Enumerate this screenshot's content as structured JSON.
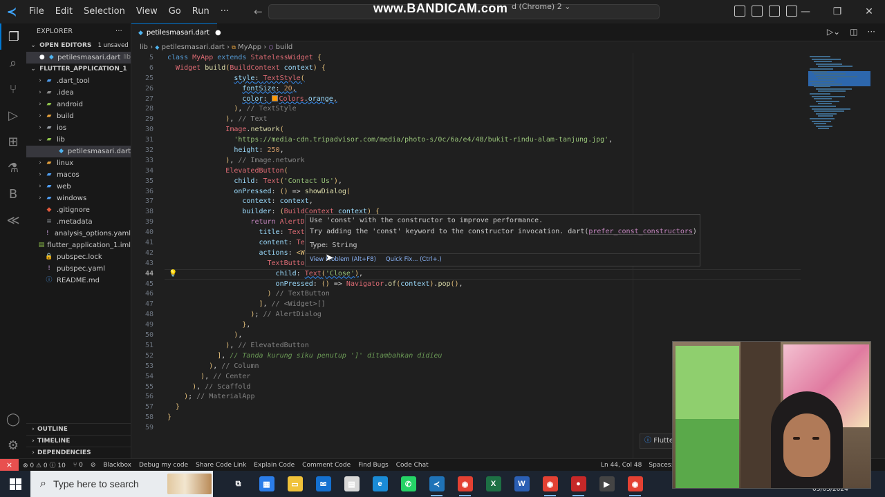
{
  "titlebar": {
    "menus": [
      "File",
      "Edit",
      "Selection",
      "View",
      "Go",
      "Run",
      "···"
    ],
    "watermark": "www.BANDICAM.com",
    "watermark_extra": "d (Chrome) 2 ⌄",
    "window_controls": [
      "—",
      "❐",
      "✕"
    ]
  },
  "activity_bar": {
    "icons": [
      "explorer-icon",
      "search-icon",
      "source-control-icon",
      "run-debug-icon",
      "extensions-icon",
      "testing-icon",
      "blackbox-icon",
      "flutter-icon"
    ],
    "bottom_icons": [
      "account-icon",
      "settings-icon"
    ]
  },
  "sidebar": {
    "title": "EXPLORER",
    "open_editors": {
      "label": "OPEN EDITORS",
      "badge": "1 unsaved",
      "items": [
        {
          "name": "petilesmasari.dart",
          "hint": "lib"
        }
      ]
    },
    "project": {
      "label": "FLUTTER_APPLICATION_1",
      "items": [
        {
          "name": ".dart_tool",
          "type": "folder",
          "depth": 1,
          "color": "#4f9df0"
        },
        {
          "name": ".idea",
          "type": "folder",
          "depth": 1,
          "color": "#8a8a8a"
        },
        {
          "name": "android",
          "type": "folder",
          "depth": 1,
          "color": "#8ec14b"
        },
        {
          "name": "build",
          "type": "folder",
          "depth": 1,
          "color": "#e8a33d"
        },
        {
          "name": "ios",
          "type": "folder",
          "depth": 1,
          "color": "#9aa0a6"
        },
        {
          "name": "lib",
          "type": "folder-open",
          "depth": 1,
          "color": "#8ec14b"
        },
        {
          "name": "petilesmasari.dart",
          "type": "dart",
          "depth": 2,
          "color": "#4fb4f0"
        },
        {
          "name": "linux",
          "type": "folder",
          "depth": 1,
          "color": "#e8a33d"
        },
        {
          "name": "macos",
          "type": "folder",
          "depth": 1,
          "color": "#4f9df0"
        },
        {
          "name": "web",
          "type": "folder",
          "depth": 1,
          "color": "#4f9df0"
        },
        {
          "name": "windows",
          "type": "folder",
          "depth": 1,
          "color": "#4f9df0"
        },
        {
          "name": ".gitignore",
          "type": "git",
          "depth": 1,
          "color": "#e35a3c"
        },
        {
          "name": ".metadata",
          "type": "file",
          "depth": 1,
          "color": "#9aa0a6"
        },
        {
          "name": "analysis_options.yaml",
          "type": "yaml",
          "depth": 1,
          "color": "#c9a0dc"
        },
        {
          "name": "flutter_application_1.iml",
          "type": "iml",
          "depth": 1,
          "color": "#8ec14b"
        },
        {
          "name": "pubspec.lock",
          "type": "lock",
          "depth": 1,
          "color": "#e8c33d"
        },
        {
          "name": "pubspec.yaml",
          "type": "yaml",
          "depth": 1,
          "color": "#c9a0dc"
        },
        {
          "name": "README.md",
          "type": "md",
          "depth": 1,
          "color": "#4f9df0"
        }
      ]
    },
    "bottom_sections": [
      "OUTLINE",
      "TIMELINE",
      "DEPENDENCIES"
    ]
  },
  "editor": {
    "tab": {
      "label": "petilesmasari.dart",
      "modified": "●"
    },
    "breadcrumb": [
      "lib",
      "petilesmasari.dart",
      "MyApp",
      "build"
    ],
    "current_line": 44,
    "hover": {
      "message_1": "Use 'const' with the constructor to improve performance.",
      "message_2": "Try adding the 'const' keyword to the constructor invocation. dart(",
      "rule": "prefer_const_constructors",
      "message_2_end": ")",
      "type_label": "Type:",
      "type_value": "String",
      "view_problem": "View Problem (Alt+F8)",
      "quick_fix": "Quick Fix... (Ctrl+.)"
    }
  },
  "statusbar": {
    "remote": "⨯",
    "problems": "⊗ 0 ⚠ 0 ⓘ 10",
    "ports": "⑂ 0",
    "items": [
      "Blackbox",
      "Debug my code",
      "Share Code Link",
      "Explain Code",
      "Comment Code",
      "Find Bugs",
      "Code Chat"
    ],
    "position": "Ln 44, Col 48",
    "spaces": "Spaces: 2"
  },
  "notification": {
    "icon": "ⓘ",
    "text": "Flutte"
  },
  "taskbar": {
    "search_placeholder": "Type here to search",
    "apps": [
      {
        "name": "task-view-icon",
        "glyph": "⧉",
        "bg": "transparent"
      },
      {
        "name": "store-icon",
        "glyph": "▦",
        "bg": "#2b7de9"
      },
      {
        "name": "file-explorer-icon",
        "glyph": "▭",
        "bg": "#f0c23a"
      },
      {
        "name": "mail-icon",
        "glyph": "✉",
        "bg": "#1470d0"
      },
      {
        "name": "app-icon",
        "glyph": "▤",
        "bg": "#d8d8d8"
      },
      {
        "name": "edge-icon",
        "glyph": "e",
        "bg": "#1a8bd6"
      },
      {
        "name": "whatsapp-icon",
        "glyph": "✆",
        "bg": "#25d366"
      },
      {
        "name": "vscode-icon",
        "glyph": "≺",
        "bg": "#1f73b8"
      },
      {
        "name": "chrome-icon",
        "glyph": "◉",
        "bg": "#e34133"
      },
      {
        "name": "excel-icon",
        "glyph": "X",
        "bg": "#1d7044"
      },
      {
        "name": "word-icon",
        "glyph": "W",
        "bg": "#2b5fb4"
      },
      {
        "name": "chrome-icon-2",
        "glyph": "◉",
        "bg": "#e34133"
      },
      {
        "name": "record-icon",
        "glyph": "●",
        "bg": "#c62828"
      },
      {
        "name": "media-player-icon",
        "glyph": "▶",
        "bg": "#444444"
      },
      {
        "name": "chrome-icon-3",
        "glyph": "◉",
        "bg": "#e34133"
      }
    ],
    "clock": "03/05/2024"
  },
  "code_lines": [
    {
      "n": 5,
      "html": "<span class=\"kw\">class</span> <span class=\"r\">MyApp</span> <span class=\"kw\">extends</span> <span class=\"r\">StatelessWidget</span> <span class=\"y\">{</span>"
    },
    {
      "n": 6,
      "html": "  <span class=\"r\">Widget</span> <span class=\"f\">build</span><span class=\"y\">(</span><span class=\"r\">BuildContext</span> <span class=\"p\">context</span><span class=\"y\">)</span> <span class=\"y\">{</span>"
    },
    {
      "n": 25,
      "html": "                <span class=\"sq\"><span class=\"p\">style</span>: <span class=\"r\">TextStyle</span><span class=\"y\">(</span></span>"
    },
    {
      "n": 26,
      "html": "                  <span class=\"sq\"><span class=\"p\">fontSize</span>: <span class=\"o\">20</span>,</span>"
    },
    {
      "n": 27,
      "html": "                  <span class=\"sq\"><span class=\"p\">color</span>: <span class=\"swatch\"></span><span class=\"r\">Colors</span>.<span class=\"p\">orange</span>,</span>"
    },
    {
      "n": 28,
      "html": "                <span class=\"y\">)</span>, <span class=\"cm\">// TextStyle</span>"
    },
    {
      "n": 29,
      "html": "              <span class=\"y\">)</span>, <span class=\"cm\">// Text</span>"
    },
    {
      "n": 30,
      "html": "              <span class=\"r\">Image</span>.<span class=\"f\">network</span><span class=\"y\">(</span>"
    },
    {
      "n": 31,
      "html": "                <span class=\"g\">'https://media-cdn.tripadvisor.com/media/photo-s/0c/6a/e4/48/bukit-rindu-alam-tanjung.jpg'</span>,"
    },
    {
      "n": 32,
      "html": "                <span class=\"p\">height</span>: <span class=\"o\">250</span>,"
    },
    {
      "n": 33,
      "html": "              <span class=\"y\">)</span>, <span class=\"cm\">// Image.network</span>"
    },
    {
      "n": 34,
      "html": "              <span class=\"r\">ElevatedButton</span><span class=\"y\">(</span>"
    },
    {
      "n": 35,
      "html": "                <span class=\"p\">child</span>: <span class=\"r\">Text</span><span class=\"y\">(</span><span class=\"g\">'Contact Us'</span><span class=\"y\">)</span>,"
    },
    {
      "n": 36,
      "html": "                <span class=\"p\">onPressed</span>: <span class=\"y\">()</span> => <span class=\"f\">showDialog</span><span class=\"y\">(</span>"
    },
    {
      "n": 37,
      "html": "                  <span class=\"p\">context</span>: <span class=\"p\">context</span>,"
    },
    {
      "n": 38,
      "html": "                  <span class=\"p\">builder</span>: <span class=\"y\">(</span><span class=\"r\">BuildContext</span> <span class=\"p\">context</span><span class=\"y\">)</span> <span class=\"y\">{</span>"
    },
    {
      "n": 39,
      "html": "                    <span class=\"k\">return</span> <span class=\"r\">AlertD</span>"
    },
    {
      "n": 40,
      "html": "                      <span class=\"p\">title</span>: <span class=\"r\">Text</span>"
    },
    {
      "n": 41,
      "html": "                      <span class=\"p\">content</span>: <span class=\"r\">Te</span>"
    },
    {
      "n": 42,
      "html": "                      <span class=\"p\">actions</span>: <span class=\"y\">&lt;W</span>"
    },
    {
      "n": 43,
      "html": "                        <span class=\"r\">TextButto</span>"
    },
    {
      "n": 44,
      "html": "                          <span class=\"p\">child</span>: <span class=\"sq\"><span class=\"r\">Text</span><span class=\"y\">(</span><span class=\"g\">'Close'</span><span class=\"y\">)</span></span>,"
    },
    {
      "n": 45,
      "html": "                          <span class=\"p\">onPressed</span>: <span class=\"y\">()</span> => <span class=\"r\">Navigator</span>.<span class=\"f\">of</span><span class=\"y\">(</span><span class=\"p\">context</span><span class=\"y\">)</span>.<span class=\"f\">pop</span><span class=\"y\">()</span>,"
    },
    {
      "n": 46,
      "html": "                        <span class=\"y\">)</span> <span class=\"cm\">// TextButton</span>"
    },
    {
      "n": 47,
      "html": "                      <span class=\"y\">]</span>, <span class=\"cm\">// &lt;Widget&gt;[]</span>"
    },
    {
      "n": 48,
      "html": "                    <span class=\"y\">)</span>; <span class=\"cm\">// AlertDialog</span>"
    },
    {
      "n": 49,
      "html": "                  <span class=\"y\">}</span>,"
    },
    {
      "n": 50,
      "html": "                <span class=\"y\">)</span>,"
    },
    {
      "n": 51,
      "html": "              <span class=\"y\">)</span>, <span class=\"cm\">// ElevatedButton</span>"
    },
    {
      "n": 52,
      "html": "            <span class=\"y\">]</span>, <span class=\"c\">// Tanda kurung siku penutup ']' ditambahkan didieu</span>"
    },
    {
      "n": 53,
      "html": "          <span class=\"y\">)</span>, <span class=\"cm\">// Column</span>"
    },
    {
      "n": 54,
      "html": "        <span class=\"y\">)</span>, <span class=\"cm\">// Center</span>"
    },
    {
      "n": 55,
      "html": "      <span class=\"y\">)</span>, <span class=\"cm\">// Scaffold</span>"
    },
    {
      "n": 56,
      "html": "    <span class=\"y\">)</span>; <span class=\"cm\">// MaterialApp</span>"
    },
    {
      "n": 57,
      "html": "  <span class=\"y\">}</span>"
    },
    {
      "n": 58,
      "html": "<span class=\"y\">}</span>"
    },
    {
      "n": 59,
      "html": ""
    }
  ]
}
